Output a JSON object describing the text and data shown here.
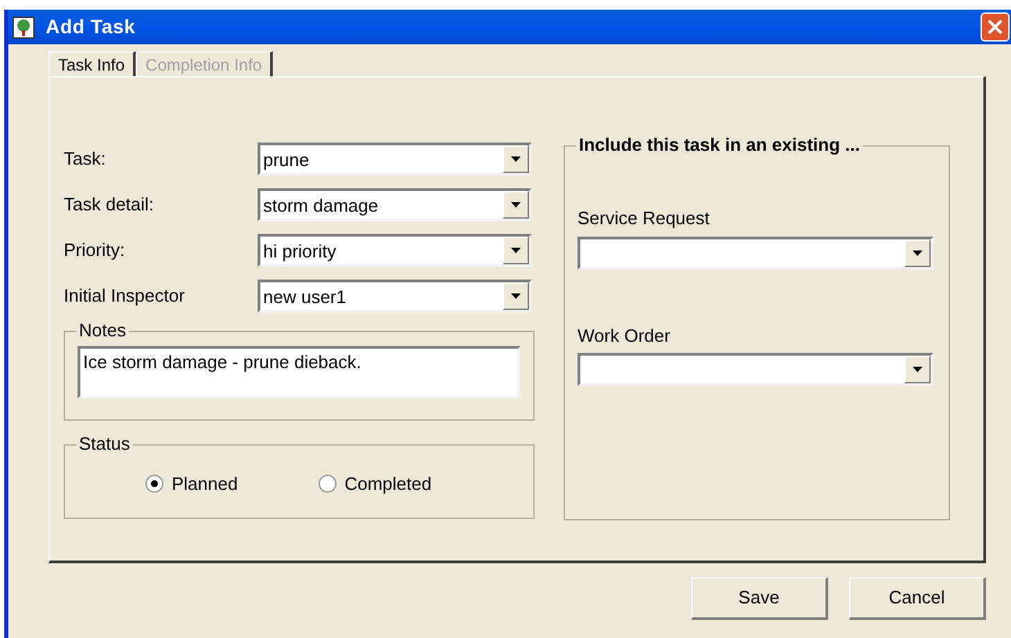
{
  "window": {
    "title": "Add Task"
  },
  "tabs": [
    {
      "label": "Task Info",
      "selected": true
    },
    {
      "label": "Completion Info",
      "selected": false
    }
  ],
  "fields": [
    {
      "label": "Task:",
      "value": "prune"
    },
    {
      "label": "Task detail:",
      "value": "storm damage"
    },
    {
      "label": "Priority:",
      "value": "hi priority"
    },
    {
      "label": "Initial Inspector",
      "value": "new user1"
    }
  ],
  "notes": {
    "title": "Notes",
    "value": "Ice storm damage - prune dieback."
  },
  "status": {
    "title": "Status",
    "options": [
      {
        "label": "Planned",
        "selected": true
      },
      {
        "label": "Completed",
        "selected": false
      }
    ]
  },
  "include_group": {
    "title": "Include this task in an existing ...",
    "fields": [
      {
        "label": "Service Request"
      },
      {
        "label": "Work Order"
      }
    ]
  },
  "buttons": [
    "Save",
    "Cancel"
  ]
}
